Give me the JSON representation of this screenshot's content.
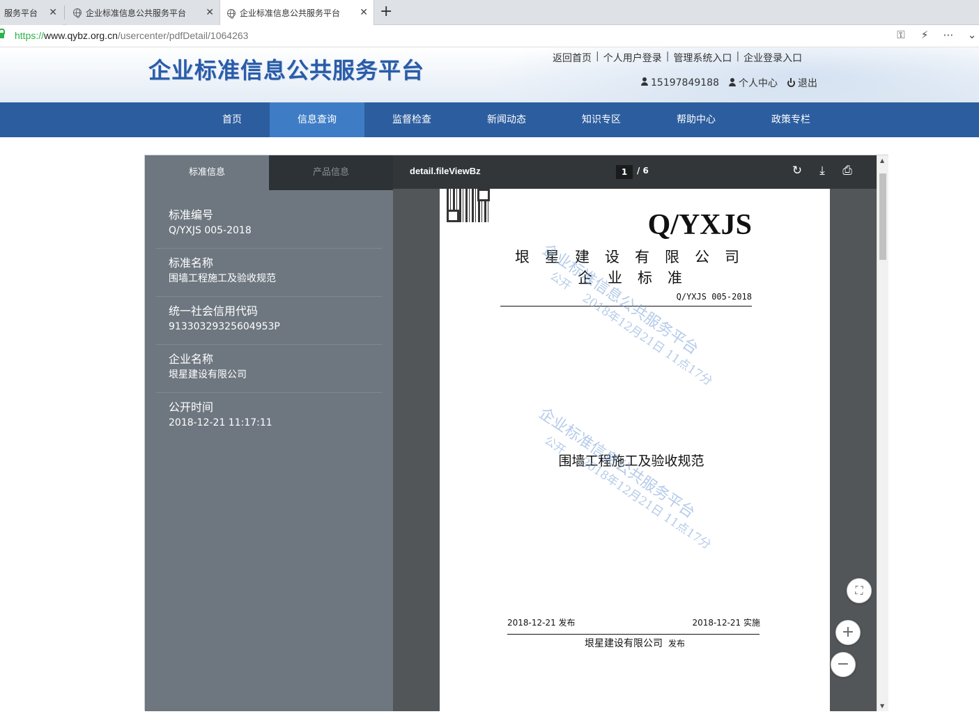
{
  "browser": {
    "tabs": [
      {
        "title": "服务平台",
        "close": "✕"
      },
      {
        "title": "企业标准信息公共服务平台",
        "close": "✕"
      },
      {
        "title": "企业标准信息公共服务平台",
        "close": "✕"
      }
    ],
    "new_tab": "+",
    "url": {
      "proto": "https://",
      "host": "www.qybz.org.cn",
      "path": "/usercenter/pdfDetail/1064263"
    }
  },
  "site": {
    "logo_text": "企业标准信息公共服务平台",
    "top_links": [
      "返回首页",
      "个人用户登录",
      "管理系统入口",
      "企业登录入口"
    ],
    "link_separator": "|",
    "user": {
      "phone": "15197849188",
      "center": "个人中心",
      "logout": "退出"
    },
    "nav": [
      {
        "label": "首页",
        "active": false
      },
      {
        "label": "信息查询",
        "active": true
      },
      {
        "label": "监督检查",
        "active": false
      },
      {
        "label": "新闻动态",
        "active": false
      },
      {
        "label": "知识专区",
        "active": false
      },
      {
        "label": "帮助中心",
        "active": false
      },
      {
        "label": "政策专栏",
        "active": false
      }
    ]
  },
  "sidebar": {
    "tabs": [
      "标准信息",
      "产品信息"
    ],
    "items": [
      {
        "label": "标准编号",
        "value": "Q/YXJS 005-2018"
      },
      {
        "label": "标准名称",
        "value": "围墙工程施工及验收规范"
      },
      {
        "label": "统一社会信用代码",
        "value": "91330329325604953P"
      },
      {
        "label": "企业名称",
        "value": "垠星建设有限公司"
      },
      {
        "label": "公开时间",
        "value": "2018-12-21 11:17:11"
      }
    ]
  },
  "viewer": {
    "doc_title": "detail.fileViewBz",
    "page_current": "1",
    "page_total": "/  6",
    "icons": {
      "rotate": "↻",
      "download": "⤓",
      "print": "⎙"
    },
    "fab": {
      "fullscreen": "⛶",
      "zoom_in": "+",
      "zoom_out": "−"
    }
  },
  "document": {
    "code": "Q/YXJS",
    "company": "垠星建设有限公司",
    "standard_type": "企业标准",
    "standard_no": "Q/YXJS 005-2018",
    "title": "围墙工程施工及验收规范",
    "publish_date": "2018-12-21  发布",
    "implement_date": "2018-12-21  实施",
    "publisher": "垠星建设有限公司",
    "publisher_suffix": "发布",
    "watermark": {
      "line1": "企业标准信息公共服务平台",
      "line2": "公开",
      "line3": "2018年12月21日  11点17分"
    }
  },
  "colors": {
    "nav_bg": "#2c5d9e",
    "nav_active": "#3f7cc6",
    "sidebar_bg": "#6e7780",
    "viewer_bg": "#525659",
    "toolbar_bg": "#323639",
    "logo": "#2a5ca8"
  }
}
